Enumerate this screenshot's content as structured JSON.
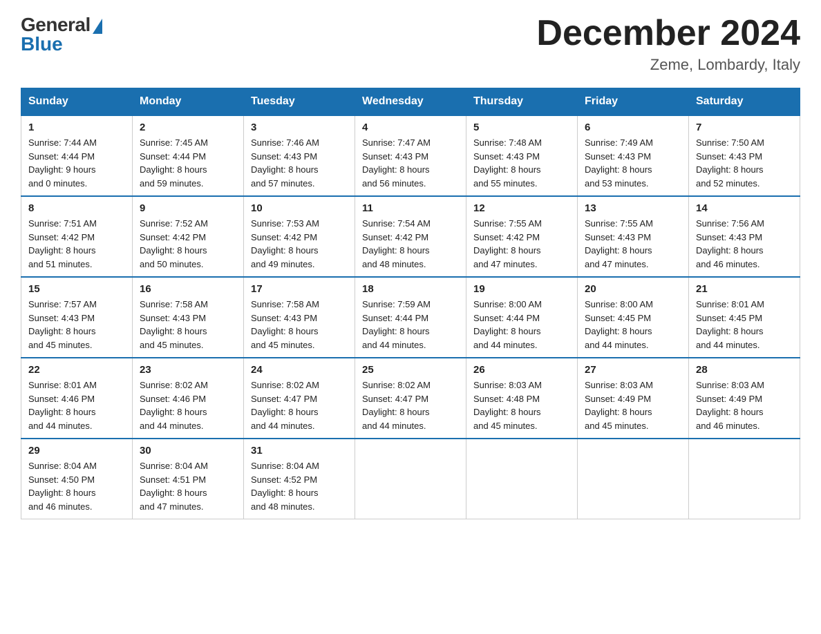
{
  "logo": {
    "general": "General",
    "blue": "Blue"
  },
  "header": {
    "month_title": "December 2024",
    "location": "Zeme, Lombardy, Italy"
  },
  "days_of_week": [
    "Sunday",
    "Monday",
    "Tuesday",
    "Wednesday",
    "Thursday",
    "Friday",
    "Saturday"
  ],
  "weeks": [
    [
      {
        "day": "1",
        "sunrise": "7:44 AM",
        "sunset": "4:44 PM",
        "daylight": "9 hours and 0 minutes."
      },
      {
        "day": "2",
        "sunrise": "7:45 AM",
        "sunset": "4:44 PM",
        "daylight": "8 hours and 59 minutes."
      },
      {
        "day": "3",
        "sunrise": "7:46 AM",
        "sunset": "4:43 PM",
        "daylight": "8 hours and 57 minutes."
      },
      {
        "day": "4",
        "sunrise": "7:47 AM",
        "sunset": "4:43 PM",
        "daylight": "8 hours and 56 minutes."
      },
      {
        "day": "5",
        "sunrise": "7:48 AM",
        "sunset": "4:43 PM",
        "daylight": "8 hours and 55 minutes."
      },
      {
        "day": "6",
        "sunrise": "7:49 AM",
        "sunset": "4:43 PM",
        "daylight": "8 hours and 53 minutes."
      },
      {
        "day": "7",
        "sunrise": "7:50 AM",
        "sunset": "4:43 PM",
        "daylight": "8 hours and 52 minutes."
      }
    ],
    [
      {
        "day": "8",
        "sunrise": "7:51 AM",
        "sunset": "4:42 PM",
        "daylight": "8 hours and 51 minutes."
      },
      {
        "day": "9",
        "sunrise": "7:52 AM",
        "sunset": "4:42 PM",
        "daylight": "8 hours and 50 minutes."
      },
      {
        "day": "10",
        "sunrise": "7:53 AM",
        "sunset": "4:42 PM",
        "daylight": "8 hours and 49 minutes."
      },
      {
        "day": "11",
        "sunrise": "7:54 AM",
        "sunset": "4:42 PM",
        "daylight": "8 hours and 48 minutes."
      },
      {
        "day": "12",
        "sunrise": "7:55 AM",
        "sunset": "4:42 PM",
        "daylight": "8 hours and 47 minutes."
      },
      {
        "day": "13",
        "sunrise": "7:55 AM",
        "sunset": "4:43 PM",
        "daylight": "8 hours and 47 minutes."
      },
      {
        "day": "14",
        "sunrise": "7:56 AM",
        "sunset": "4:43 PM",
        "daylight": "8 hours and 46 minutes."
      }
    ],
    [
      {
        "day": "15",
        "sunrise": "7:57 AM",
        "sunset": "4:43 PM",
        "daylight": "8 hours and 45 minutes."
      },
      {
        "day": "16",
        "sunrise": "7:58 AM",
        "sunset": "4:43 PM",
        "daylight": "8 hours and 45 minutes."
      },
      {
        "day": "17",
        "sunrise": "7:58 AM",
        "sunset": "4:43 PM",
        "daylight": "8 hours and 45 minutes."
      },
      {
        "day": "18",
        "sunrise": "7:59 AM",
        "sunset": "4:44 PM",
        "daylight": "8 hours and 44 minutes."
      },
      {
        "day": "19",
        "sunrise": "8:00 AM",
        "sunset": "4:44 PM",
        "daylight": "8 hours and 44 minutes."
      },
      {
        "day": "20",
        "sunrise": "8:00 AM",
        "sunset": "4:45 PM",
        "daylight": "8 hours and 44 minutes."
      },
      {
        "day": "21",
        "sunrise": "8:01 AM",
        "sunset": "4:45 PM",
        "daylight": "8 hours and 44 minutes."
      }
    ],
    [
      {
        "day": "22",
        "sunrise": "8:01 AM",
        "sunset": "4:46 PM",
        "daylight": "8 hours and 44 minutes."
      },
      {
        "day": "23",
        "sunrise": "8:02 AM",
        "sunset": "4:46 PM",
        "daylight": "8 hours and 44 minutes."
      },
      {
        "day": "24",
        "sunrise": "8:02 AM",
        "sunset": "4:47 PM",
        "daylight": "8 hours and 44 minutes."
      },
      {
        "day": "25",
        "sunrise": "8:02 AM",
        "sunset": "4:47 PM",
        "daylight": "8 hours and 44 minutes."
      },
      {
        "day": "26",
        "sunrise": "8:03 AM",
        "sunset": "4:48 PM",
        "daylight": "8 hours and 45 minutes."
      },
      {
        "day": "27",
        "sunrise": "8:03 AM",
        "sunset": "4:49 PM",
        "daylight": "8 hours and 45 minutes."
      },
      {
        "day": "28",
        "sunrise": "8:03 AM",
        "sunset": "4:49 PM",
        "daylight": "8 hours and 46 minutes."
      }
    ],
    [
      {
        "day": "29",
        "sunrise": "8:04 AM",
        "sunset": "4:50 PM",
        "daylight": "8 hours and 46 minutes."
      },
      {
        "day": "30",
        "sunrise": "8:04 AM",
        "sunset": "4:51 PM",
        "daylight": "8 hours and 47 minutes."
      },
      {
        "day": "31",
        "sunrise": "8:04 AM",
        "sunset": "4:52 PM",
        "daylight": "8 hours and 48 minutes."
      },
      null,
      null,
      null,
      null
    ]
  ],
  "labels": {
    "sunrise": "Sunrise:",
    "sunset": "Sunset:",
    "daylight": "Daylight:"
  }
}
